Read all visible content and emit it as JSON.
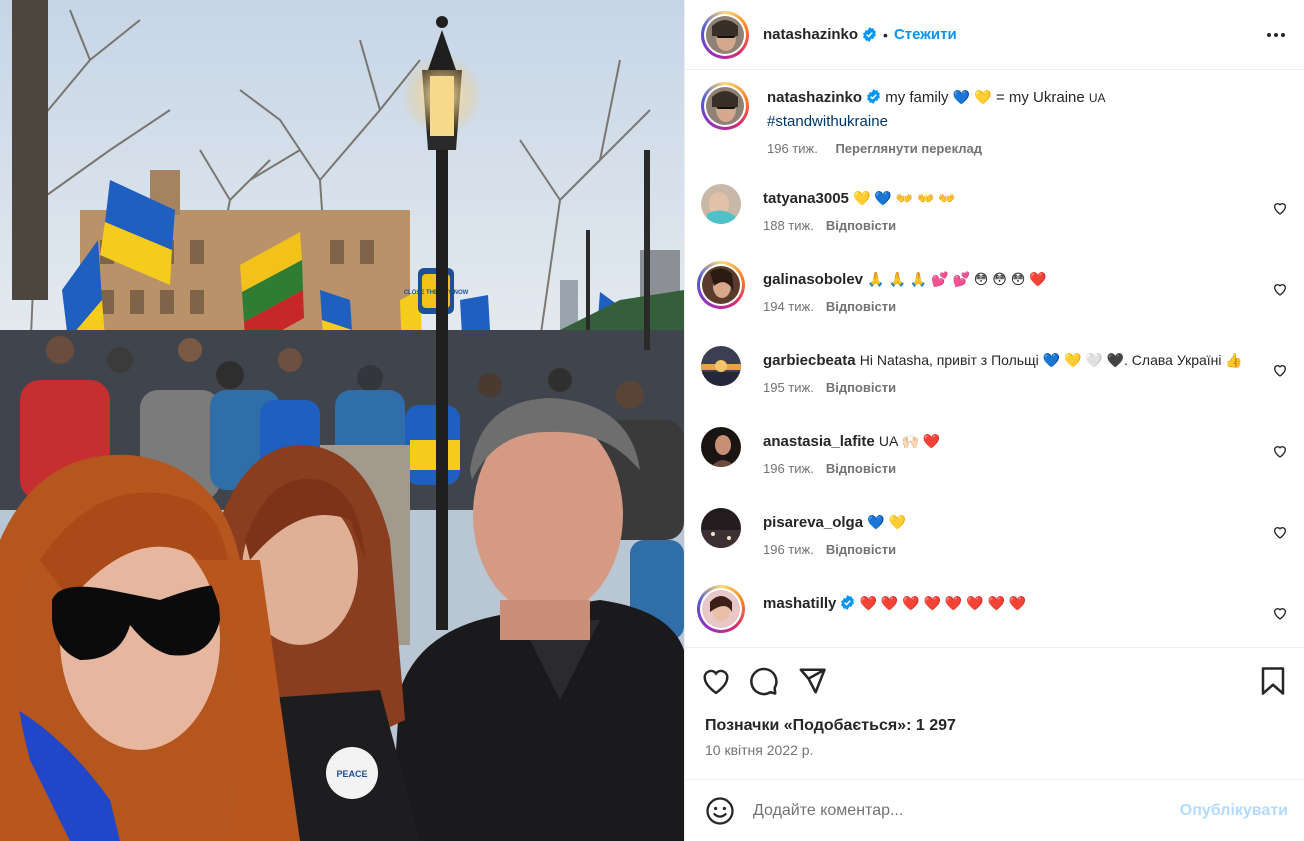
{
  "post": {
    "author": "natashazinko",
    "follow_label": "Стежити",
    "caption_pre": "my family",
    "caption_mid": " = my Ukraine",
    "caption_flag": "UA",
    "hashtag": "#standwithukraine",
    "caption_time": "196 тиж.",
    "translate_label": "Переглянути переклад"
  },
  "comments": [
    {
      "user": "tatyana3005",
      "text": "💛 💙 👐 👐 👐",
      "time": "188 тиж.",
      "reply": "Відповісти"
    },
    {
      "user": "galinasobolev",
      "text": "🙏 🙏 🙏 💕 💕 😳 😳 😳 ❤️",
      "time": "194 тиж.",
      "reply": "Відповісти"
    },
    {
      "user": "garbiecbeata",
      "text": "Hi Natasha, привіт з Польщі 💙 💛 🤍 🖤. Слава Україні 👍",
      "time": "195 тиж.",
      "reply": "Відповісти"
    },
    {
      "user": "anastasia_lafite",
      "text": "UA 🙌🏻 ❤️",
      "time": "196 тиж.",
      "reply": "Відповісти"
    },
    {
      "user": "pisareva_olga",
      "text": "💙 💛",
      "time": "196 тиж.",
      "reply": "Відповісти"
    },
    {
      "user": "mashatilly",
      "text": "❤️ ❤️ ❤️ ❤️ ❤️ ❤️ ❤️ ❤️",
      "time": "",
      "reply": ""
    }
  ],
  "likes_text": "Позначки «Подобається»: 1 297",
  "date_text": "10 квітня 2022 р.",
  "add_comment": {
    "placeholder": "Додайте коментар...",
    "publish_label": "Опублікувати"
  },
  "photo": {
    "sign_text": "CLOSE THE SKY NOW",
    "badge_text": "PEACE"
  },
  "colors": {
    "accent": "#0095f6",
    "ukraine_blue": "#1f5fbf",
    "ukraine_yellow": "#f5cc1b",
    "meta_gray": "#737373"
  }
}
